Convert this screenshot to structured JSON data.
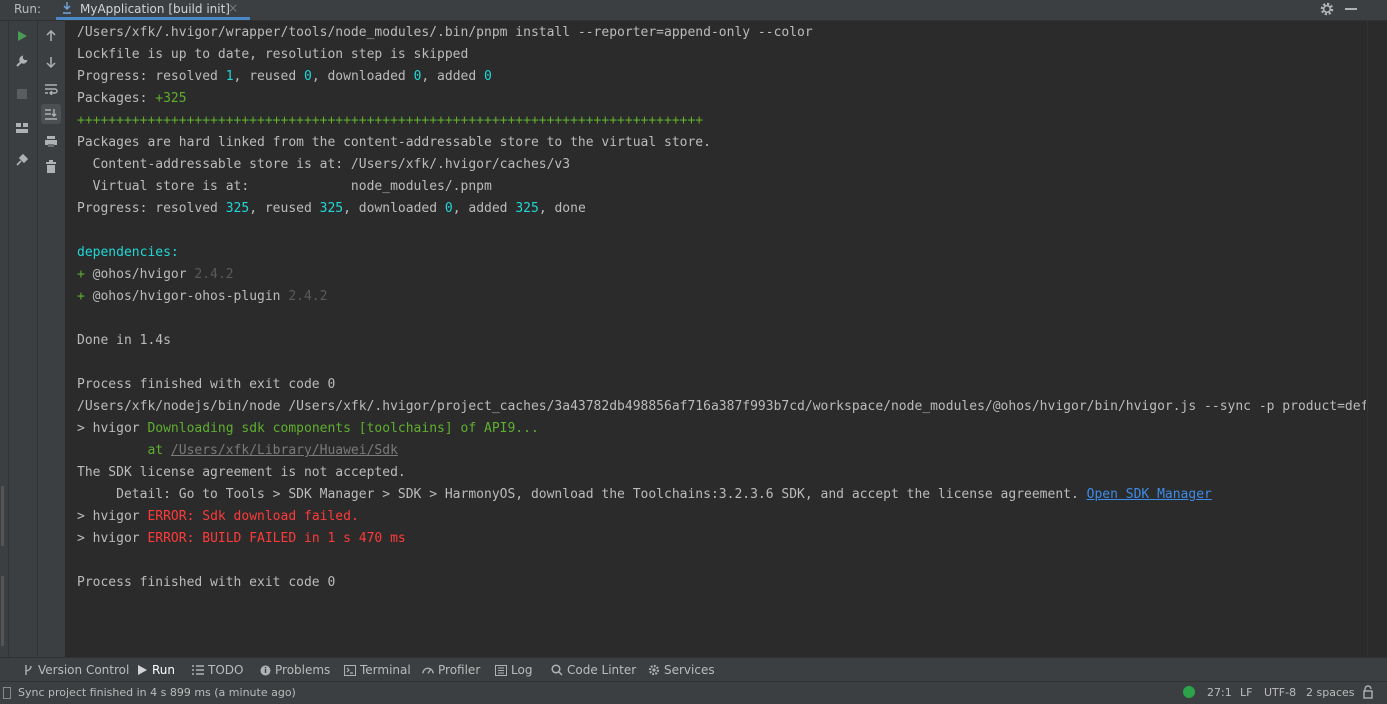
{
  "header": {
    "run_label": "Run:",
    "tab_title": "MyApplication [build init]",
    "tab_close": "×"
  },
  "console": {
    "lines": [
      [
        {
          "t": "/Users/xfk/.hvigor/wrapper/tools/node_modules/.bin/pnpm install --reporter=append-only --color"
        }
      ],
      [
        {
          "t": "Lockfile is up to date, resolution step is skipped"
        }
      ],
      [
        {
          "t": "Progress: resolved "
        },
        {
          "t": "1",
          "c": "cyan"
        },
        {
          "t": ", reused "
        },
        {
          "t": "0",
          "c": "cyan"
        },
        {
          "t": ", downloaded "
        },
        {
          "t": "0",
          "c": "cyan"
        },
        {
          "t": ", added "
        },
        {
          "t": "0",
          "c": "cyan"
        }
      ],
      [
        {
          "t": "Packages: "
        },
        {
          "t": "+325",
          "c": "green"
        }
      ],
      [
        {
          "t": "++++++++++++++++++++++++++++++++++++++++++++++++++++++++++++++++++++++++++++++++",
          "c": "green"
        }
      ],
      [
        {
          "t": "Packages are hard linked from the content-addressable store to the virtual store."
        }
      ],
      [
        {
          "t": "  Content-addressable store is at: /Users/xfk/.hvigor/caches/v3"
        }
      ],
      [
        {
          "t": "  Virtual store is at:             node_modules/.pnpm"
        }
      ],
      [
        {
          "t": "Progress: resolved "
        },
        {
          "t": "325",
          "c": "cyan"
        },
        {
          "t": ", reused "
        },
        {
          "t": "325",
          "c": "cyan"
        },
        {
          "t": ", downloaded "
        },
        {
          "t": "0",
          "c": "cyan"
        },
        {
          "t": ", added "
        },
        {
          "t": "325",
          "c": "cyan"
        },
        {
          "t": ", done"
        }
      ],
      [
        {
          "t": ""
        }
      ],
      [
        {
          "t": "dependencies:",
          "c": "cyan"
        }
      ],
      [
        {
          "t": "+ ",
          "c": "green"
        },
        {
          "t": "@ohos/hvigor "
        },
        {
          "t": "2.4.2",
          "c": "dim"
        }
      ],
      [
        {
          "t": "+ ",
          "c": "green"
        },
        {
          "t": "@ohos/hvigor-ohos-plugin "
        },
        {
          "t": "2.4.2",
          "c": "dim"
        }
      ],
      [
        {
          "t": ""
        }
      ],
      [
        {
          "t": "Done in 1.4s"
        }
      ],
      [
        {
          "t": ""
        }
      ],
      [
        {
          "t": "Process finished with exit code 0"
        }
      ],
      [
        {
          "t": "/Users/xfk/nodejs/bin/node /Users/xfk/.hvigor/project_caches/3a43782db498856af716a387f993b7cd/workspace/node_modules/@ohos/hvigor/bin/hvigor.js --sync -p product=default"
        }
      ],
      [
        {
          "t": "> hvigor "
        },
        {
          "t": "Downloading sdk components [toolchains] of API9...",
          "c": "green"
        }
      ],
      [
        {
          "t": "         at ",
          "c": "green"
        },
        {
          "t": "/Users/xfk/Library/Huawei/Sdk",
          "c": "path"
        }
      ],
      [
        {
          "t": "The SDK license agreement is not accepted."
        }
      ],
      [
        {
          "t": "     Detail: Go to Tools > SDK Manager > SDK > HarmonyOS, download the Toolchains:3.2.3.6 SDK, and accept the license agreement. "
        },
        {
          "t": "Open SDK Manager",
          "c": "link"
        }
      ],
      [
        {
          "t": "> hvigor "
        },
        {
          "t": "ERROR: Sdk download failed.",
          "c": "red"
        }
      ],
      [
        {
          "t": "> hvigor "
        },
        {
          "t": "ERROR: BUILD FAILED in 1 s 470 ms",
          "c": "red"
        }
      ],
      [
        {
          "t": ""
        }
      ],
      [
        {
          "t": "Process finished with exit code 0"
        }
      ]
    ]
  },
  "toolwindow_tabs": [
    {
      "label": "Version Control",
      "icon": "vcs-branch-icon"
    },
    {
      "label": "Run",
      "icon": "run-triangle-icon"
    },
    {
      "label": "TODO",
      "icon": "list-icon"
    },
    {
      "label": "Problems",
      "icon": "info-circle-icon"
    },
    {
      "label": "Terminal",
      "icon": "terminal-icon"
    },
    {
      "label": "Profiler",
      "icon": "gauge-icon"
    },
    {
      "label": "Log",
      "icon": "log-icon"
    },
    {
      "label": "Code Linter",
      "icon": "magnifier-icon"
    },
    {
      "label": "Services",
      "icon": "services-icon"
    }
  ],
  "status": {
    "message": "Sync project finished in 4 s 899 ms (a minute ago)",
    "position": "27:1",
    "line_sep": "LF",
    "encoding": "UTF-8",
    "indent": "2 spaces"
  },
  "colors": {
    "accent": "#4a88c7",
    "run_green": "#499c54",
    "cyan": "#21d7d7",
    "green": "#5faf2f",
    "error_red": "#ff3a3a",
    "link_blue": "#3d8ce8"
  }
}
